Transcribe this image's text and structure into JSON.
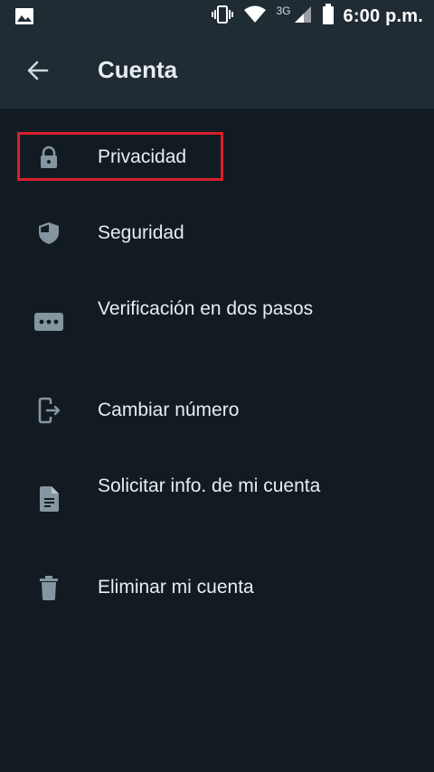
{
  "status_bar": {
    "network": "3G",
    "time": "6:00 p.m."
  },
  "header": {
    "title": "Cuenta",
    "back_icon": "arrow-left-icon"
  },
  "settings": {
    "items": [
      {
        "label": "Privacidad",
        "icon": "lock-icon",
        "highlighted": true
      },
      {
        "label": "Seguridad",
        "icon": "shield-icon"
      },
      {
        "label": "Verificación en dos pasos",
        "icon": "dots-icon"
      },
      {
        "label": "Cambiar número",
        "icon": "phone-exit-icon"
      },
      {
        "label": "Solicitar info. de mi cuenta",
        "icon": "document-icon"
      },
      {
        "label": "Eliminar mi cuenta",
        "icon": "trash-icon"
      }
    ]
  },
  "colors": {
    "background": "#121b22",
    "app_bar": "#1f2c34",
    "icon": "#8696a0",
    "text": "#e9edef",
    "highlight_border": "#d7202a"
  }
}
